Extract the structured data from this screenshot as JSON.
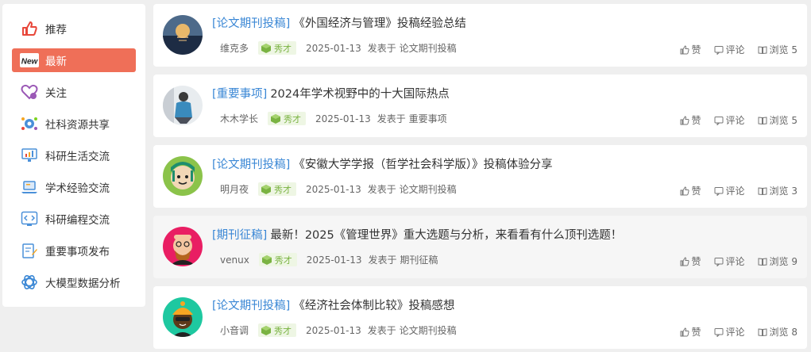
{
  "sidebar": {
    "items": [
      {
        "label": "推荐",
        "icon": "thumbs-up-icon"
      },
      {
        "label": "最新",
        "icon": "new-badge-icon",
        "active": true
      },
      {
        "label": "关注",
        "icon": "heart-icon"
      },
      {
        "label": "社科资源共享",
        "icon": "share-globe-icon"
      },
      {
        "label": "科研生活交流",
        "icon": "monitor-chart-icon"
      },
      {
        "label": "学术经验交流",
        "icon": "laptop-icon"
      },
      {
        "label": "科研编程交流",
        "icon": "code-icon"
      },
      {
        "label": "重要事项发布",
        "icon": "document-pen-icon"
      },
      {
        "label": "大模型数据分析",
        "icon": "openai-icon"
      }
    ]
  },
  "stats_labels": {
    "like": "赞",
    "comment": "评论",
    "view_prefix": "浏览"
  },
  "posts": [
    {
      "category": "[论文期刊投稿]",
      "title": "《外国经济与管理》投稿经验总结",
      "author": "维克多",
      "badge": "秀才",
      "date": "2025-01-13",
      "published_in": "发表于 论文期刊投稿",
      "views": "浏览 5"
    },
    {
      "category": "[重要事项]",
      "title": "2024年学术视野中的十大国际热点",
      "author": "木木学长",
      "badge": "秀才",
      "date": "2025-01-13",
      "published_in": "发表于 重要事项",
      "views": "浏览 5"
    },
    {
      "category": "[论文期刊投稿]",
      "title": "《安徽大学学报（哲学社会科学版）》投稿体验分享",
      "author": "明月夜",
      "badge": "秀才",
      "date": "2025-01-13",
      "published_in": "发表于 论文期刊投稿",
      "views": "浏览 3"
    },
    {
      "category": "[期刊征稿]",
      "title": "最新！2025《管理世界》重大选题与分析，来看看有什么顶刊选题！",
      "author": "venux",
      "badge": "秀才",
      "date": "2025-01-13",
      "published_in": "发表于 期刊征稿",
      "views": "浏览 9"
    },
    {
      "category": "[论文期刊投稿]",
      "title": "《经济社会体制比较》投稿感想",
      "author": "小音调",
      "badge": "秀才",
      "date": "2025-01-13",
      "published_in": "发表于 论文期刊投稿",
      "views": "浏览 8"
    }
  ],
  "colors": {
    "accent": "#ef6f58",
    "category": "#3a87d5",
    "badge_bg": "#eef6e4",
    "badge_fg": "#7ab342"
  }
}
